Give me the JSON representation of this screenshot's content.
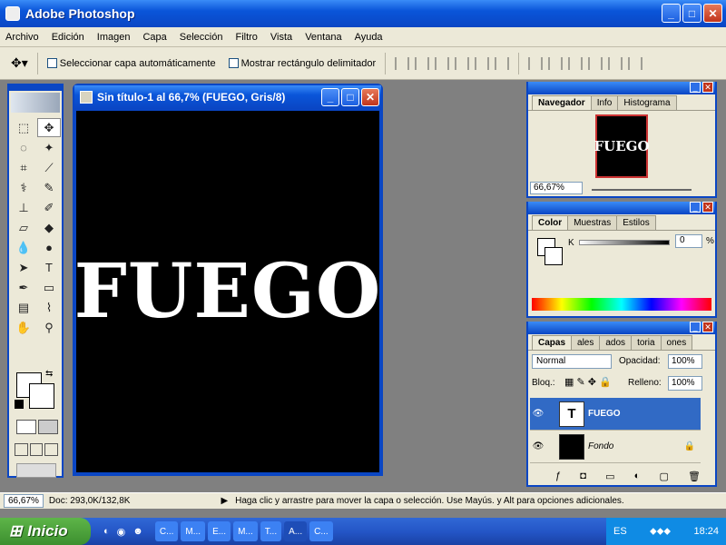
{
  "app": {
    "title": "Adobe Photoshop"
  },
  "menu": [
    "Archivo",
    "Edición",
    "Imagen",
    "Capa",
    "Selección",
    "Filtro",
    "Vista",
    "Ventana",
    "Ayuda"
  ],
  "options": {
    "auto_select": "Seleccionar capa automáticamente",
    "show_bounds": "Mostrar rectángulo delimitador"
  },
  "document": {
    "title": "Sin título-1 al 66,7% (FUEGO, Gris/8)",
    "text": "FUEGO"
  },
  "navigator": {
    "tabs": [
      "Navegador",
      "Info",
      "Histograma"
    ],
    "thumb_text": "FUEGO",
    "zoom": "66,67%"
  },
  "color": {
    "tabs": [
      "Color",
      "Muestras",
      "Estilos"
    ],
    "k_label": "K",
    "k_value": "0",
    "unit": "%"
  },
  "layers": {
    "tabs": [
      "Capas",
      "ales",
      "ados",
      "toria",
      "ones"
    ],
    "blend": "Normal",
    "opacity_label": "Opacidad:",
    "opacity": "100%",
    "lock_label": "Bloq.:",
    "fill_label": "Relleno:",
    "fill": "100%",
    "items": [
      {
        "name": "FUEGO",
        "thumb": "T"
      },
      {
        "name": "Fondo",
        "thumb": ""
      }
    ]
  },
  "status": {
    "zoom": "66,67%",
    "doc": "Doc: 293,0K/132,8K",
    "hint": "Haga clic y arrastre para mover la capa o selección. Use Mayús. y Alt para opciones adicionales."
  },
  "taskbar": {
    "start": "Inicio",
    "tasks": [
      "C...",
      "M...",
      "E...",
      "M...",
      "T...",
      "A...",
      "C..."
    ],
    "lang": "ES",
    "clock": "18:24"
  }
}
